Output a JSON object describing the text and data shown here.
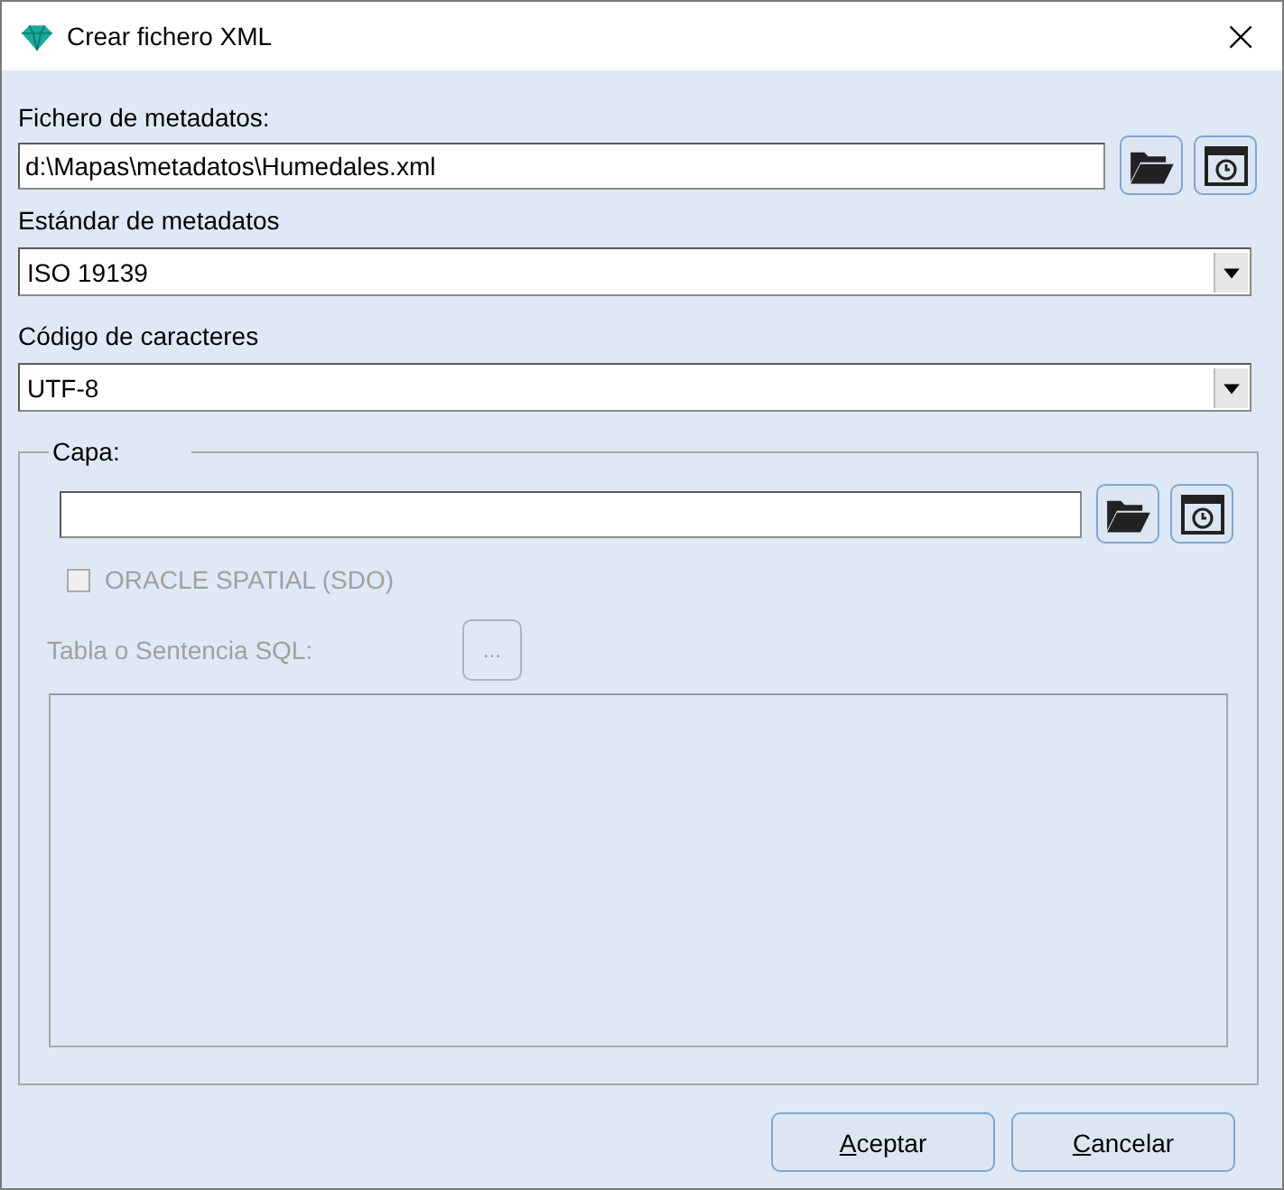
{
  "window": {
    "title": "Crear fichero XML",
    "close": "×"
  },
  "metadata_file": {
    "label": "Fichero de metadatos:",
    "value": "d:\\Mapas\\metadatos\\Humedales.xml"
  },
  "standard": {
    "label": "Estándar de metadatos",
    "value": "ISO 19139"
  },
  "encoding": {
    "label": "Código de caracteres",
    "value": "UTF-8"
  },
  "layer": {
    "legend": "Capa:",
    "oracle": {
      "label": "ORACLE SPATIAL (SDO)",
      "checked": false,
      "disabled": true
    },
    "sql": {
      "label": "Tabla o Sentencia SQL:",
      "button": "...",
      "disabled": true
    }
  },
  "buttons": [
    {
      "label": "Aceptar"
    },
    {
      "label": "Cancelar"
    }
  ]
}
